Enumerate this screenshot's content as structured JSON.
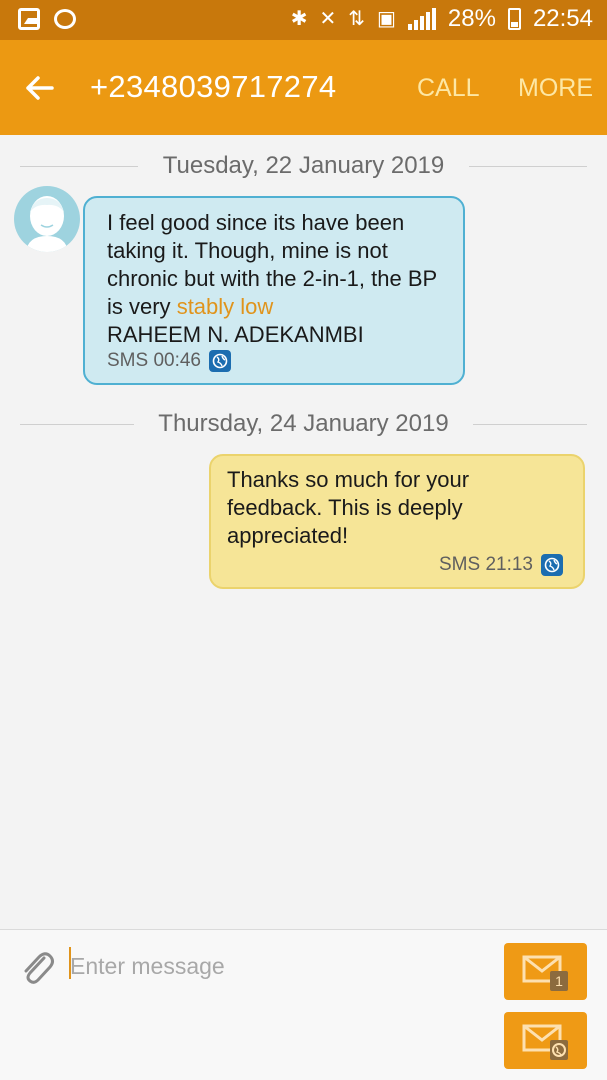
{
  "status_bar": {
    "battery": "28%",
    "time": "22:54"
  },
  "header": {
    "title": "+2348039717274",
    "call_label": "CALL",
    "more_label": "MORE"
  },
  "conversation": {
    "dates": [
      "Tuesday, 22 January 2019",
      "Thursday, 24 January 2019"
    ],
    "messages": [
      {
        "direction": "incoming",
        "lines": [
          "I feel good since its have been",
          "taking it. Though, mine is not",
          "chronic but with the 2-in-1, the BP",
          "is very ",
          "RAHEEM N. ADEKANMBI"
        ],
        "highlight": "stably low",
        "meta": "SMS 00:46"
      },
      {
        "direction": "outgoing",
        "lines": [
          "Thanks so much for your",
          "feedback. This is deeply",
          "appreciated!"
        ],
        "meta": "SMS 21:13"
      }
    ]
  },
  "composer": {
    "placeholder": "Enter message",
    "sim_badge": "1"
  },
  "colors": {
    "status_bar": "#c8780c",
    "action_bar": "#ec9912",
    "incoming_bubble": "#cfeaf1",
    "outgoing_bubble": "#f6e597",
    "accent": "#e0941c"
  },
  "icons": {
    "back": "arrow-left-icon",
    "attach": "paperclip-icon",
    "send_sim": "envelope-sim-icon",
    "send_network": "envelope-globe-icon",
    "network": "globe-icon"
  }
}
